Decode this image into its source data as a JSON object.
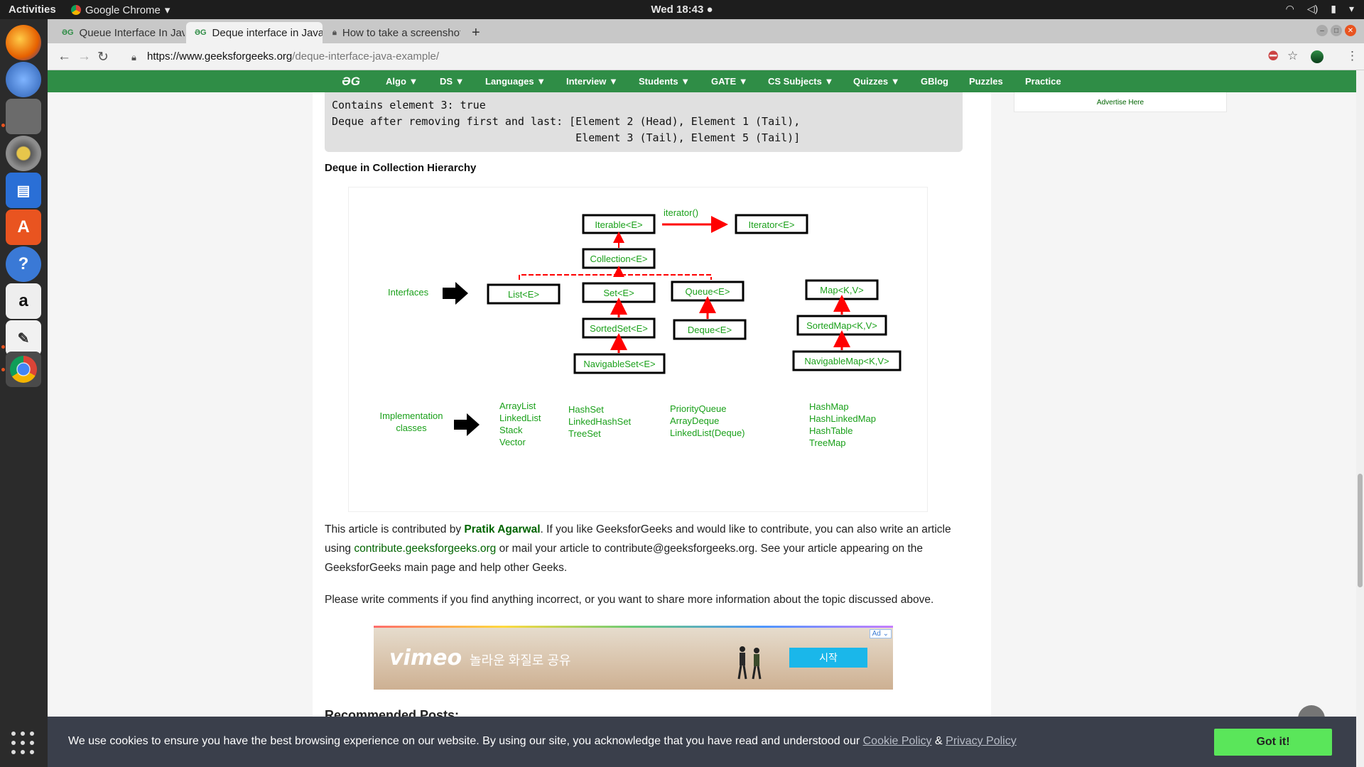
{
  "topbar": {
    "activities": "Activities",
    "app": "Google Chrome",
    "clock": "Wed 18:43 ●"
  },
  "tabs": [
    {
      "label": "Queue Interface In Java -"
    },
    {
      "label": "Deque interface in Java w"
    },
    {
      "label": "How to take a screenshot"
    }
  ],
  "omnibar": {
    "url_scheme_host": "https://www.geeksforgeeks.org",
    "url_path": "/deque-interface-java-example/"
  },
  "nav": {
    "logo": "ƏG",
    "items": [
      "Algo ▼",
      "DS ▼",
      "Languages ▼",
      "Interview ▼",
      "Students ▼",
      "GATE ▼",
      "CS Subjects ▼",
      "Quizzes ▼",
      "GBlog",
      "Puzzles",
      "Practice"
    ]
  },
  "sidebar": {
    "advertise": "Advertise Here"
  },
  "code": {
    "lines": [
      "Contains element 3: true",
      "Deque after removing first and last: [Element 2 (Head), Element 1 (Tail),",
      "                                      Element 3 (Tail), Element 5 (Tail)]"
    ]
  },
  "article": {
    "section_heading": "Deque in Collection Hierarchy",
    "p1_a": "This article is contributed by ",
    "p1_author": "Pratik Agarwal",
    "p1_b": ". If you like GeeksforGeeks and would like to contribute, you can also write an article using ",
    "p1_link": "contribute.geeksforgeeks.org",
    "p1_c": " or mail your article to contribute@geeksforgeeks.org. See your article appearing on the GeeksforGeeks main page and help other Geeks.",
    "p2": "Please write comments if you find anything incorrect, or you want to share more information about the topic discussed above.",
    "recommended": "Recommended Posts:"
  },
  "diagram": {
    "colors": {
      "text": "#1aa01a",
      "arrow": "#ff0000",
      "box": "#000000"
    },
    "iterable": "Iterable<E>",
    "iterator_call": "iterator()",
    "iterator": "Iterator<E>",
    "collection": "Collection<E>",
    "interfaces_label": "Interfaces",
    "list": "List<E>",
    "set": "Set<E>",
    "queue": "Queue<E>",
    "map": "Map<K,V>",
    "sortedset": "SortedSet<E>",
    "deque": "Deque<E>",
    "sortedmap": "SortedMap<K,V>",
    "navigableset": "NavigableSet<E>",
    "navigablemap": "NavigableMap<K,V>",
    "impl_label_1": "Implementation",
    "impl_label_2": "classes",
    "impl_list": [
      "ArrayList",
      "LinkedList",
      "Stack",
      "Vector"
    ],
    "impl_set": [
      "HashSet",
      "LinkedHashSet",
      "TreeSet"
    ],
    "impl_queue": [
      "PriorityQueue",
      "ArrayDeque",
      "LinkedList(Deque)"
    ],
    "impl_map": [
      "HashMap",
      "HashLinkedMap",
      "HashTable",
      "TreeMap"
    ]
  },
  "ad": {
    "brand": "vimeo",
    "slogan": "놀라운 화질로 공유",
    "cta": "시작",
    "tag": "Ad ⌄"
  },
  "cookie": {
    "message": "We use cookies to ensure you have the best browsing experience on our website. By using our site, you acknowledge that you have read and understood our ",
    "cookie_policy": "Cookie Policy",
    "amp": "&",
    "privacy_policy": "Privacy Policy",
    "button": "Got it!"
  }
}
